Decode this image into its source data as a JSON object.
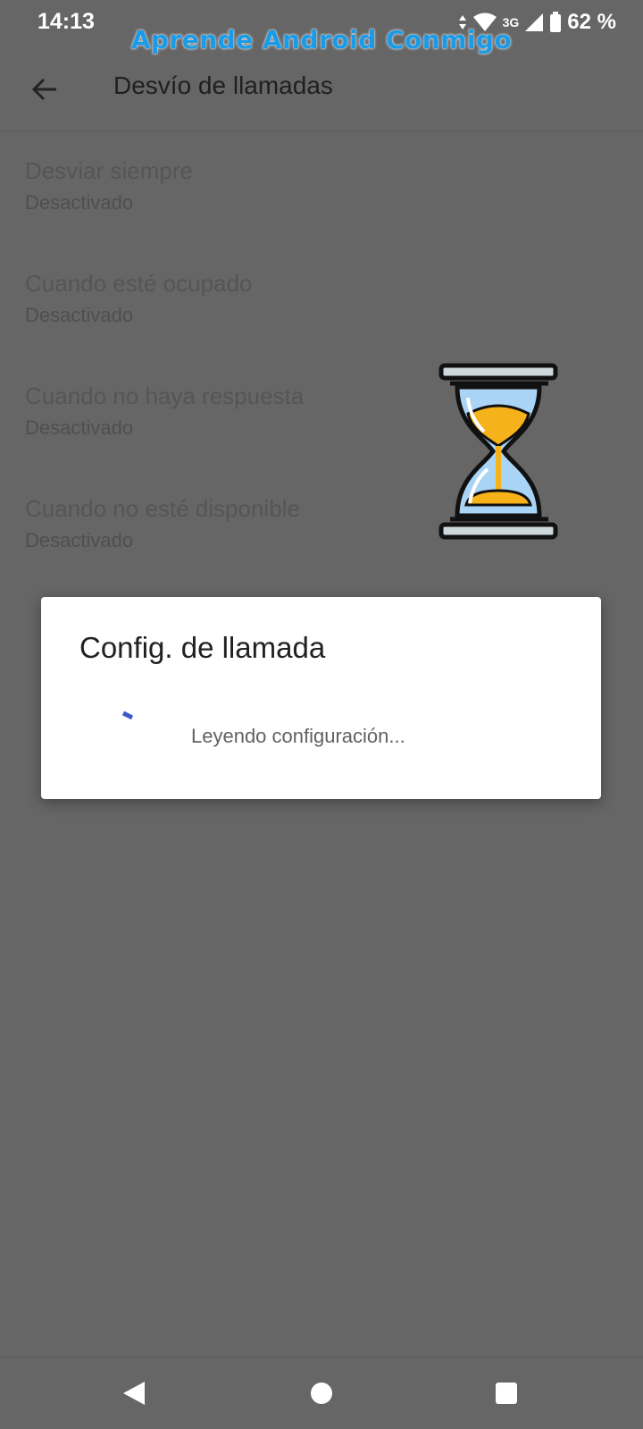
{
  "status_bar": {
    "time": "14:13",
    "network": "3G",
    "battery": "62 %"
  },
  "watermark": "Aprende Android Conmigo",
  "app_bar": {
    "title": "Desvío de llamadas",
    "back_icon": "arrow-back-icon"
  },
  "settings": [
    {
      "title": "Desviar siempre",
      "summary": "Desactivado"
    },
    {
      "title": "Cuando esté ocupado",
      "summary": "Desactivado"
    },
    {
      "title": "Cuando no haya respuesta",
      "summary": "Desactivado"
    },
    {
      "title": "Cuando no esté disponible",
      "summary": "Desactivado"
    }
  ],
  "dialog": {
    "title": "Config. de llamada",
    "message": "Leyendo configuración..."
  },
  "colors": {
    "background": "#666666",
    "watermark": "#1a9be8",
    "spinner": "#3b5bc7",
    "hourglass_sand": "#f6b21b",
    "hourglass_glass": "#a9d4f5"
  },
  "nav_bar": {
    "back_icon": "triangle-back-icon",
    "home_icon": "circle-home-icon",
    "recents_icon": "square-recents-icon"
  }
}
